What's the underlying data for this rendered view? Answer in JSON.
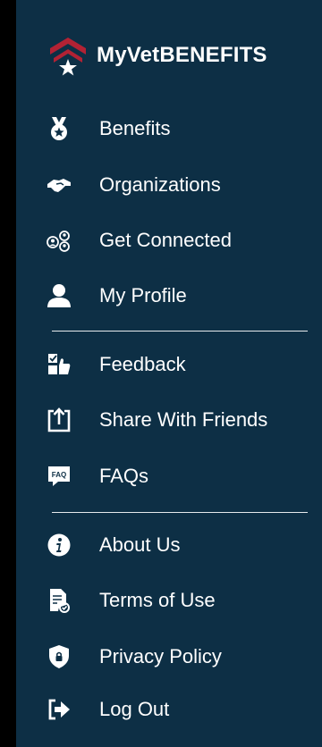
{
  "app": {
    "logo_text": "MyVetBENEFITS"
  },
  "menu": {
    "benefits": "Benefits",
    "organizations": "Organizations",
    "get_connected": "Get Connected",
    "my_profile": "My Profile",
    "feedback": "Feedback",
    "share": "Share With Friends",
    "faqs": "FAQs",
    "about": "About Us",
    "terms": "Terms of Use",
    "privacy": "Privacy Policy",
    "logout": "Log Out"
  },
  "icons": {
    "benefits": "medal-icon",
    "organizations": "handshake-icon",
    "get_connected": "people-network-icon",
    "my_profile": "user-icon",
    "feedback": "feedback-icon",
    "share": "share-icon",
    "faqs": "faq-icon",
    "about": "info-icon",
    "terms": "document-check-icon",
    "privacy": "shield-lock-icon",
    "logout": "logout-icon"
  },
  "colors": {
    "drawer_background": "#0d2f45",
    "text": "#ffffff",
    "logo_chevron": "#b22234"
  }
}
